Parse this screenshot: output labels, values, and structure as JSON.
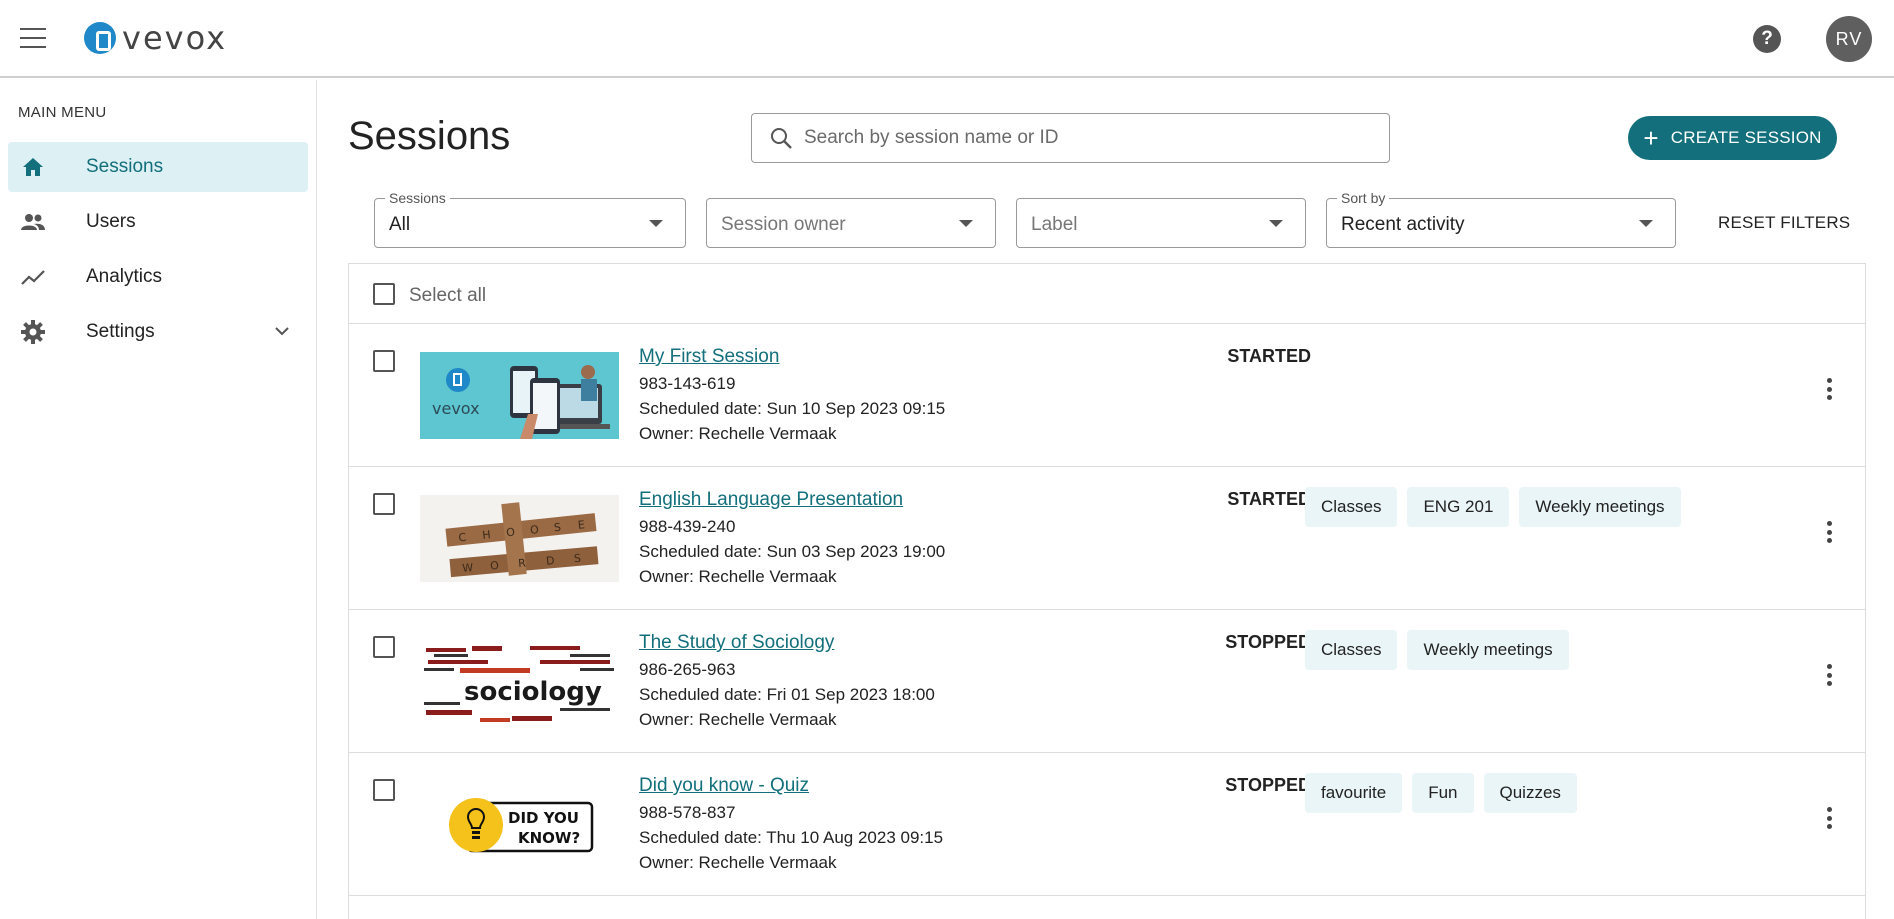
{
  "header": {
    "logo_text": "vevox",
    "help": "?",
    "avatar_initials": "RV"
  },
  "sidebar": {
    "heading": "MAIN MENU",
    "items": [
      {
        "label": "Sessions",
        "icon": "home-icon"
      },
      {
        "label": "Users",
        "icon": "users-icon"
      },
      {
        "label": "Analytics",
        "icon": "trend-icon"
      },
      {
        "label": "Settings",
        "icon": "gear-icon"
      }
    ]
  },
  "main": {
    "title": "Sessions",
    "search_placeholder": "Search by session name or ID",
    "create_label": "CREATE SESSION",
    "filters": {
      "sessions": {
        "label": "Sessions",
        "value": "All"
      },
      "owner": {
        "placeholder": "Session owner"
      },
      "label": {
        "placeholder": "Label"
      },
      "sort": {
        "label": "Sort by",
        "value": "Recent activity"
      }
    },
    "reset_label": "RESET FILTERS",
    "select_all": "Select all"
  },
  "sessions": [
    {
      "name": "My First Session",
      "id": "983-143-619",
      "scheduled": "Scheduled date: Sun 10 Sep 2023 09:15",
      "owner": "Owner: Rechelle Vermaak",
      "status": "STARTED",
      "tags": []
    },
    {
      "name": "English Language Presentation",
      "id": "988-439-240",
      "scheduled": "Scheduled date: Sun 03 Sep 2023 19:00",
      "owner": "Owner: Rechelle Vermaak",
      "status": "STARTED",
      "tags": [
        "Classes",
        "ENG 201",
        "Weekly meetings"
      ]
    },
    {
      "name": "The Study of Sociology",
      "id": "986-265-963",
      "scheduled": "Scheduled date: Fri 01 Sep 2023 18:00",
      "owner": "Owner: Rechelle Vermaak",
      "status": "STOPPED",
      "tags": [
        "Classes",
        "Weekly meetings"
      ]
    },
    {
      "name": "Did you know - Quiz",
      "id": "988-578-837",
      "scheduled": "Scheduled date: Thu 10 Aug 2023 09:15",
      "owner": "Owner: Rechelle Vermaak",
      "status": "STOPPED",
      "tags": [
        "favourite",
        "Fun",
        "Quizzes"
      ]
    }
  ],
  "thumbnails": {
    "vevox_text": "vevox",
    "words": [
      "C",
      "H",
      "O",
      "O",
      "S",
      "E"
    ],
    "words2": [
      "W",
      "O",
      "R",
      "D",
      "S"
    ],
    "sociology": "sociology",
    "did_you_know": [
      "DID YOU",
      "KNOW?"
    ]
  },
  "colors": {
    "accent": "#126f7b",
    "active_bg": "#ddf0f3",
    "tag_bg": "#eaf5f7"
  }
}
